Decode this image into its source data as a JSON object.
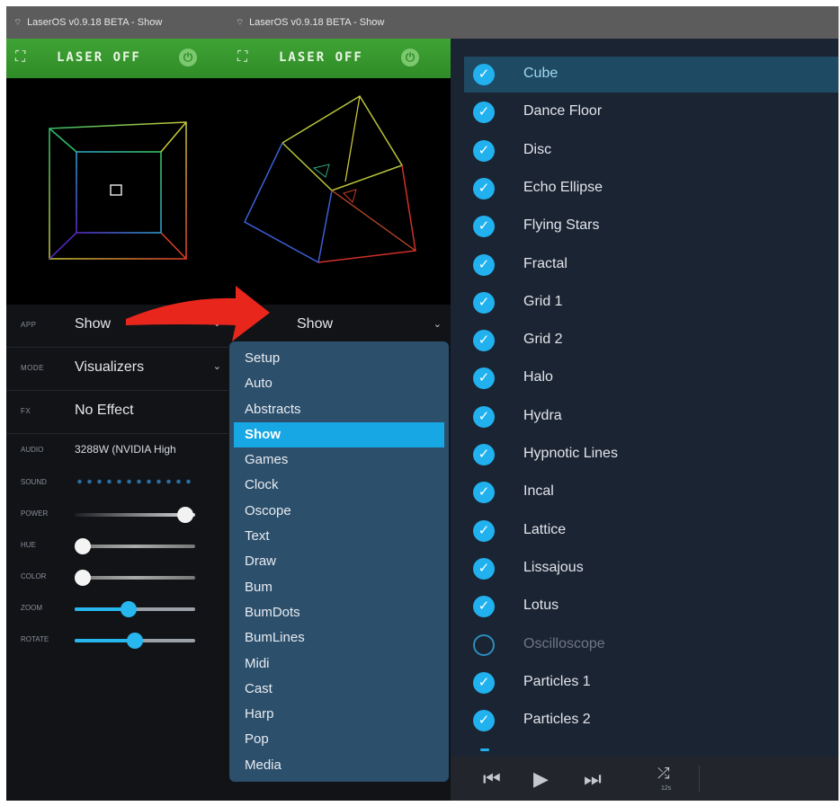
{
  "window_title": "LaserOS v0.9.18 BETA - Show",
  "laser": {
    "label": "LASER OFF"
  },
  "left": {
    "app_key": "APP",
    "app_value": "Show",
    "mode_key": "MODE",
    "mode_value": "Visualizers",
    "fx_key": "FX",
    "fx_value": "No Effect",
    "audio_key": "AUDIO",
    "audio_value": "3288W (NVIDIA High",
    "sound_key": "SOUND",
    "power_key": "POWER",
    "power_level": 0.92,
    "hue_key": "HUE",
    "hue_level": 0.07,
    "color_key": "COLOR",
    "color_level": 0.07,
    "zoom_key": "ZOOM",
    "zoom_level": 0.45,
    "rotate_key": "ROTATE",
    "rotate_level": 0.5
  },
  "right": {
    "app_value": "Show",
    "dropdown_options": [
      "Setup",
      "Auto",
      "Abstracts",
      "Show",
      "Games",
      "Clock",
      "Oscope",
      "Text",
      "Draw",
      "Bum",
      "BumDots",
      "BumLines",
      "Midi",
      "Cast",
      "Harp",
      "Pop",
      "Media"
    ],
    "dropdown_selected": "Show",
    "visualizers": [
      {
        "name": "Cube",
        "checked": true,
        "active": true
      },
      {
        "name": "Dance Floor",
        "checked": true
      },
      {
        "name": "Disc",
        "checked": true
      },
      {
        "name": "Echo Ellipse",
        "checked": true
      },
      {
        "name": "Flying Stars",
        "checked": true
      },
      {
        "name": "Fractal",
        "checked": true
      },
      {
        "name": "Grid 1",
        "checked": true
      },
      {
        "name": "Grid 2",
        "checked": true
      },
      {
        "name": "Halo",
        "checked": true
      },
      {
        "name": "Hydra",
        "checked": true
      },
      {
        "name": "Hypnotic Lines",
        "checked": true
      },
      {
        "name": "Incal",
        "checked": true
      },
      {
        "name": "Lattice",
        "checked": true
      },
      {
        "name": "Lissajous",
        "checked": true
      },
      {
        "name": "Lotus",
        "checked": true
      },
      {
        "name": "Oscilloscope",
        "checked": false
      },
      {
        "name": "Particles 1",
        "checked": true
      },
      {
        "name": "Particles 2",
        "checked": true
      }
    ],
    "player": {
      "shuffle_label": "12s"
    }
  },
  "colors": {
    "laser_green": "#3a9a31",
    "accent_blue": "#21b1ee",
    "arrow_red": "#e8261c"
  }
}
